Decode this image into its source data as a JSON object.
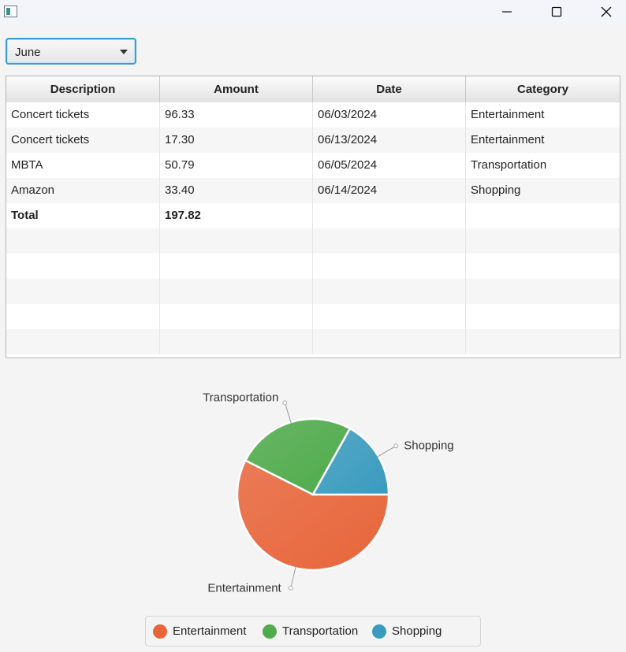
{
  "window": {
    "minimize_icon": "minimize-icon",
    "maximize_icon": "maximize-icon",
    "close_icon": "close-icon"
  },
  "month_select": {
    "value": "June"
  },
  "table": {
    "headers": [
      "Description",
      "Amount",
      "Date",
      "Category"
    ],
    "rows": [
      [
        "Concert tickets",
        "96.33",
        "06/03/2024",
        "Entertainment"
      ],
      [
        "Concert tickets",
        "17.30",
        "06/13/2024",
        "Entertainment"
      ],
      [
        "MBTA",
        "50.79",
        "06/05/2024",
        "Transportation"
      ],
      [
        "Amazon",
        "33.40",
        "06/14/2024",
        "Shopping"
      ]
    ],
    "total": {
      "label": "Total",
      "amount": "197.82"
    },
    "empty_rows": 5
  },
  "chart_data": {
    "type": "pie",
    "slices": [
      {
        "label": "Entertainment",
        "value": 113.63,
        "color": "#e8653a"
      },
      {
        "label": "Transportation",
        "value": 50.79,
        "color": "#4fab4b"
      },
      {
        "label": "Shopping",
        "value": 33.4,
        "color": "#3a9bbf"
      }
    ],
    "legend": {
      "placement": "bottom"
    }
  }
}
